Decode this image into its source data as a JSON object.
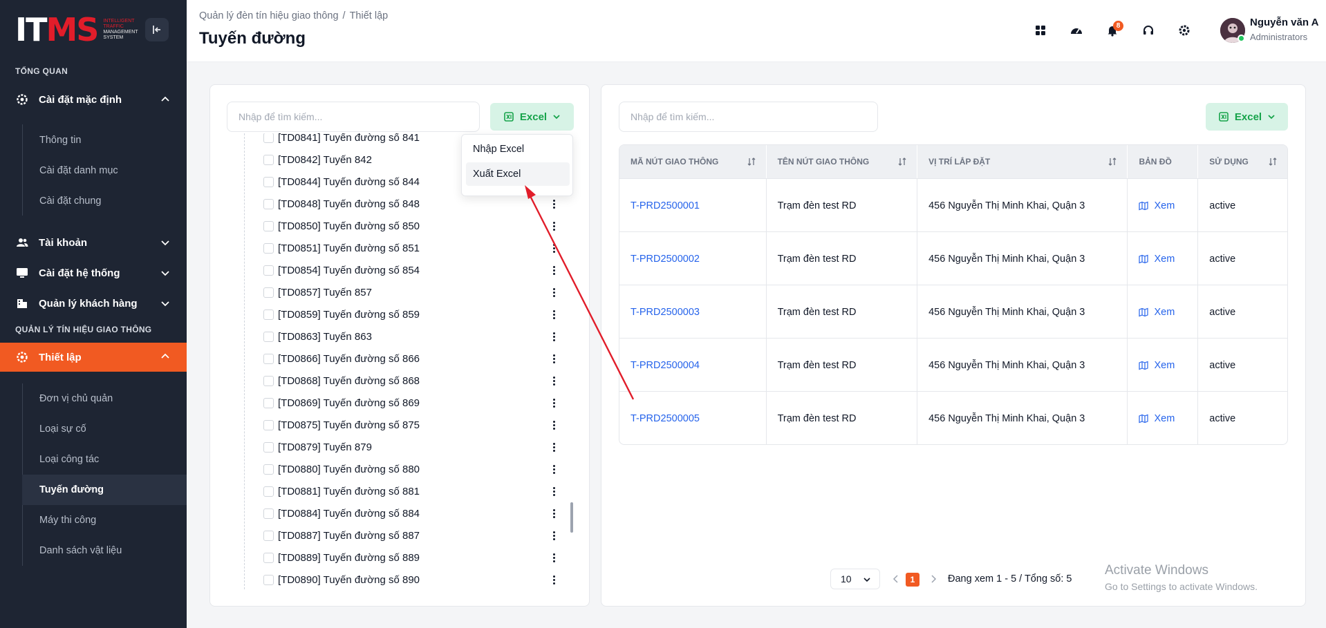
{
  "logo": {
    "mark_a": "IT",
    "mark_b": "MS",
    "sub_red": "INTELLIGENT TRAFFIC",
    "sub": "MANAGEMENT SYSTEM"
  },
  "sidebar": {
    "section_overview": "TỔNG QUAN",
    "group_defaults": "Cài đặt mặc định",
    "defaults_items": [
      "Thông tin",
      "Cài đặt danh mục",
      "Cài đặt chung"
    ],
    "group_account": "Tài khoản",
    "group_system": "Cài đặt hệ thống",
    "group_customers": "Quản lý khách hàng",
    "section_traffic": "QUẢN LÝ TÍN HIỆU GIAO THÔNG",
    "group_setup": "Thiết lập",
    "setup_items": [
      "Đơn vị chủ quản",
      "Loại sự cố",
      "Loại công tác",
      "Tuyến đường",
      "Máy thi công",
      "Danh sách vật liệu"
    ],
    "selected_item": "Tuyến đường"
  },
  "header": {
    "breadcrumb_root": "Quản lý đèn tín hiệu giao thông",
    "breadcrumb_sep": "/",
    "breadcrumb_current": "Thiết lập",
    "title": "Tuyến đường",
    "notification_count": "8",
    "user_name": "Nguyễn văn A",
    "user_role": "Administrators"
  },
  "left_panel": {
    "search_placeholder": "Nhập để tìm kiếm...",
    "excel_label": "Excel",
    "dropdown": [
      "Nhập Excel",
      "Xuất Excel"
    ],
    "routes": [
      "[TD0841] Tuyến đường số 841",
      "[TD0842] Tuyến 842",
      "[TD0844] Tuyến đường số 844",
      "[TD0848] Tuyến đường số 848",
      "[TD0850] Tuyến đường số 850",
      "[TD0851] Tuyến đường số 851",
      "[TD0854] Tuyến đường số 854",
      "[TD0857] Tuyến 857",
      "[TD0859] Tuyến đường số 859",
      "[TD0863] Tuyến 863",
      "[TD0866] Tuyến đường số 866",
      "[TD0868] Tuyến đường số 868",
      "[TD0869] Tuyến đường số 869",
      "[TD0875] Tuyến đường số 875",
      "[TD0879] Tuyến 879",
      "[TD0880] Tuyến đường số 880",
      "[TD0881] Tuyến đường số 881",
      "[TD0884] Tuyến đường số 884",
      "[TD0887] Tuyến đường số 887",
      "[TD0889] Tuyến đường số 889",
      "[TD0890] Tuyến đường số 890"
    ]
  },
  "right_panel": {
    "search_placeholder": "Nhập để tìm kiếm...",
    "excel_label": "Excel",
    "columns": [
      "MÃ NÚT GIAO THÔNG",
      "TÊN NÚT GIAO THÔNG",
      "VỊ TRÍ LẮP ĐẶT",
      "BẢN ĐỒ",
      "SỬ DỤNG"
    ],
    "rows": [
      {
        "code": "T-PRD2500001",
        "name": "Trạm đèn test RD",
        "location": "456 Nguyễn Thị Minh Khai, Quận 3",
        "map": "Xem",
        "status": "active"
      },
      {
        "code": "T-PRD2500002",
        "name": "Trạm đèn test RD",
        "location": "456 Nguyễn Thị Minh Khai, Quận 3",
        "map": "Xem",
        "status": "active"
      },
      {
        "code": "T-PRD2500003",
        "name": "Trạm đèn test RD",
        "location": "456 Nguyễn Thị Minh Khai, Quận 3",
        "map": "Xem",
        "status": "active"
      },
      {
        "code": "T-PRD2500004",
        "name": "Trạm đèn test RD",
        "location": "456 Nguyễn Thị Minh Khai, Quận 3",
        "map": "Xem",
        "status": "active"
      },
      {
        "code": "T-PRD2500005",
        "name": "Trạm đèn test RD",
        "location": "456 Nguyễn Thị Minh Khai, Quận 3",
        "map": "Xem",
        "status": "active"
      }
    ],
    "page_size": "10",
    "current_page": "1",
    "page_info": "Đang xem 1 - 5 / Tổng số: 5"
  },
  "watermark": {
    "line1": "Activate Windows",
    "line2": "Go to Settings to activate Windows."
  },
  "colors": {
    "accent": "#f15a22",
    "sidebar_bg": "#1e2533",
    "excel_bg": "#d7f3e6",
    "excel_text": "#16a34a",
    "link": "#2563eb",
    "annotation_arrow": "#e11d2a"
  },
  "icons": [
    "collapse-sidebar-icon",
    "settings-gear-icon",
    "users-icon",
    "monitor-icon",
    "building-icon",
    "apps-grid-icon",
    "dashboard-gauge-icon",
    "bell-icon",
    "headset-icon",
    "gear-icon",
    "excel-icon",
    "chevron-down-icon",
    "chevron-up-icon",
    "sort-icon",
    "map-icon",
    "more-vertical-icon",
    "chevron-left-icon",
    "chevron-right-icon"
  ]
}
